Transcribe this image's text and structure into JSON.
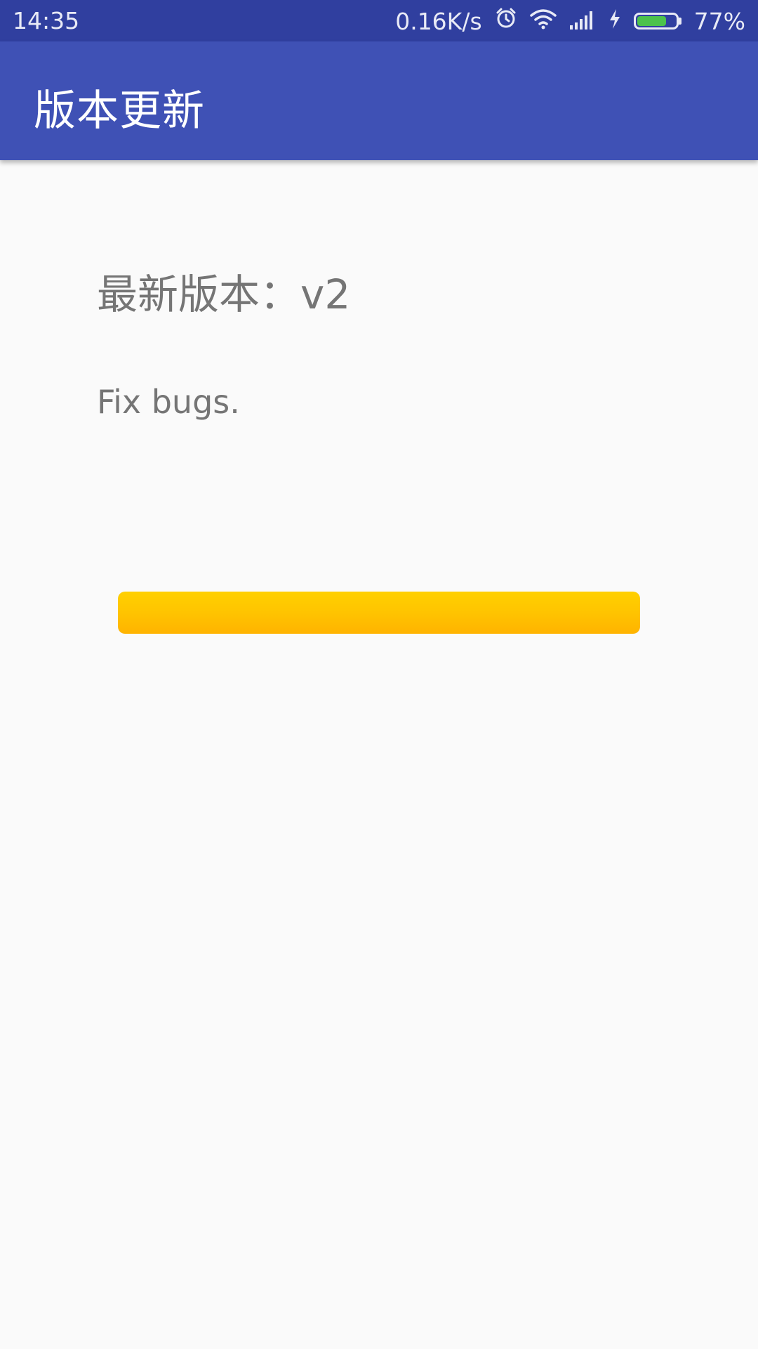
{
  "status_bar": {
    "time": "14:35",
    "network_speed": "0.16K/s",
    "battery_percent_label": "77%",
    "battery_level": 0.77,
    "icons": [
      "alarm-icon",
      "wifi-icon",
      "cell-signal-icon",
      "charging-icon",
      "battery-icon"
    ]
  },
  "app_bar": {
    "title": "版本更新"
  },
  "content": {
    "version_label": "最新版本：v2",
    "release_notes": "Fix bugs.",
    "download_progress": 1.0
  },
  "colors": {
    "status_bar": "#303f9f",
    "app_bar": "#3f51b5",
    "background": "#fafafa",
    "text_secondary": "#757575",
    "progress": "#ffc107",
    "battery": "#4cc24c"
  }
}
